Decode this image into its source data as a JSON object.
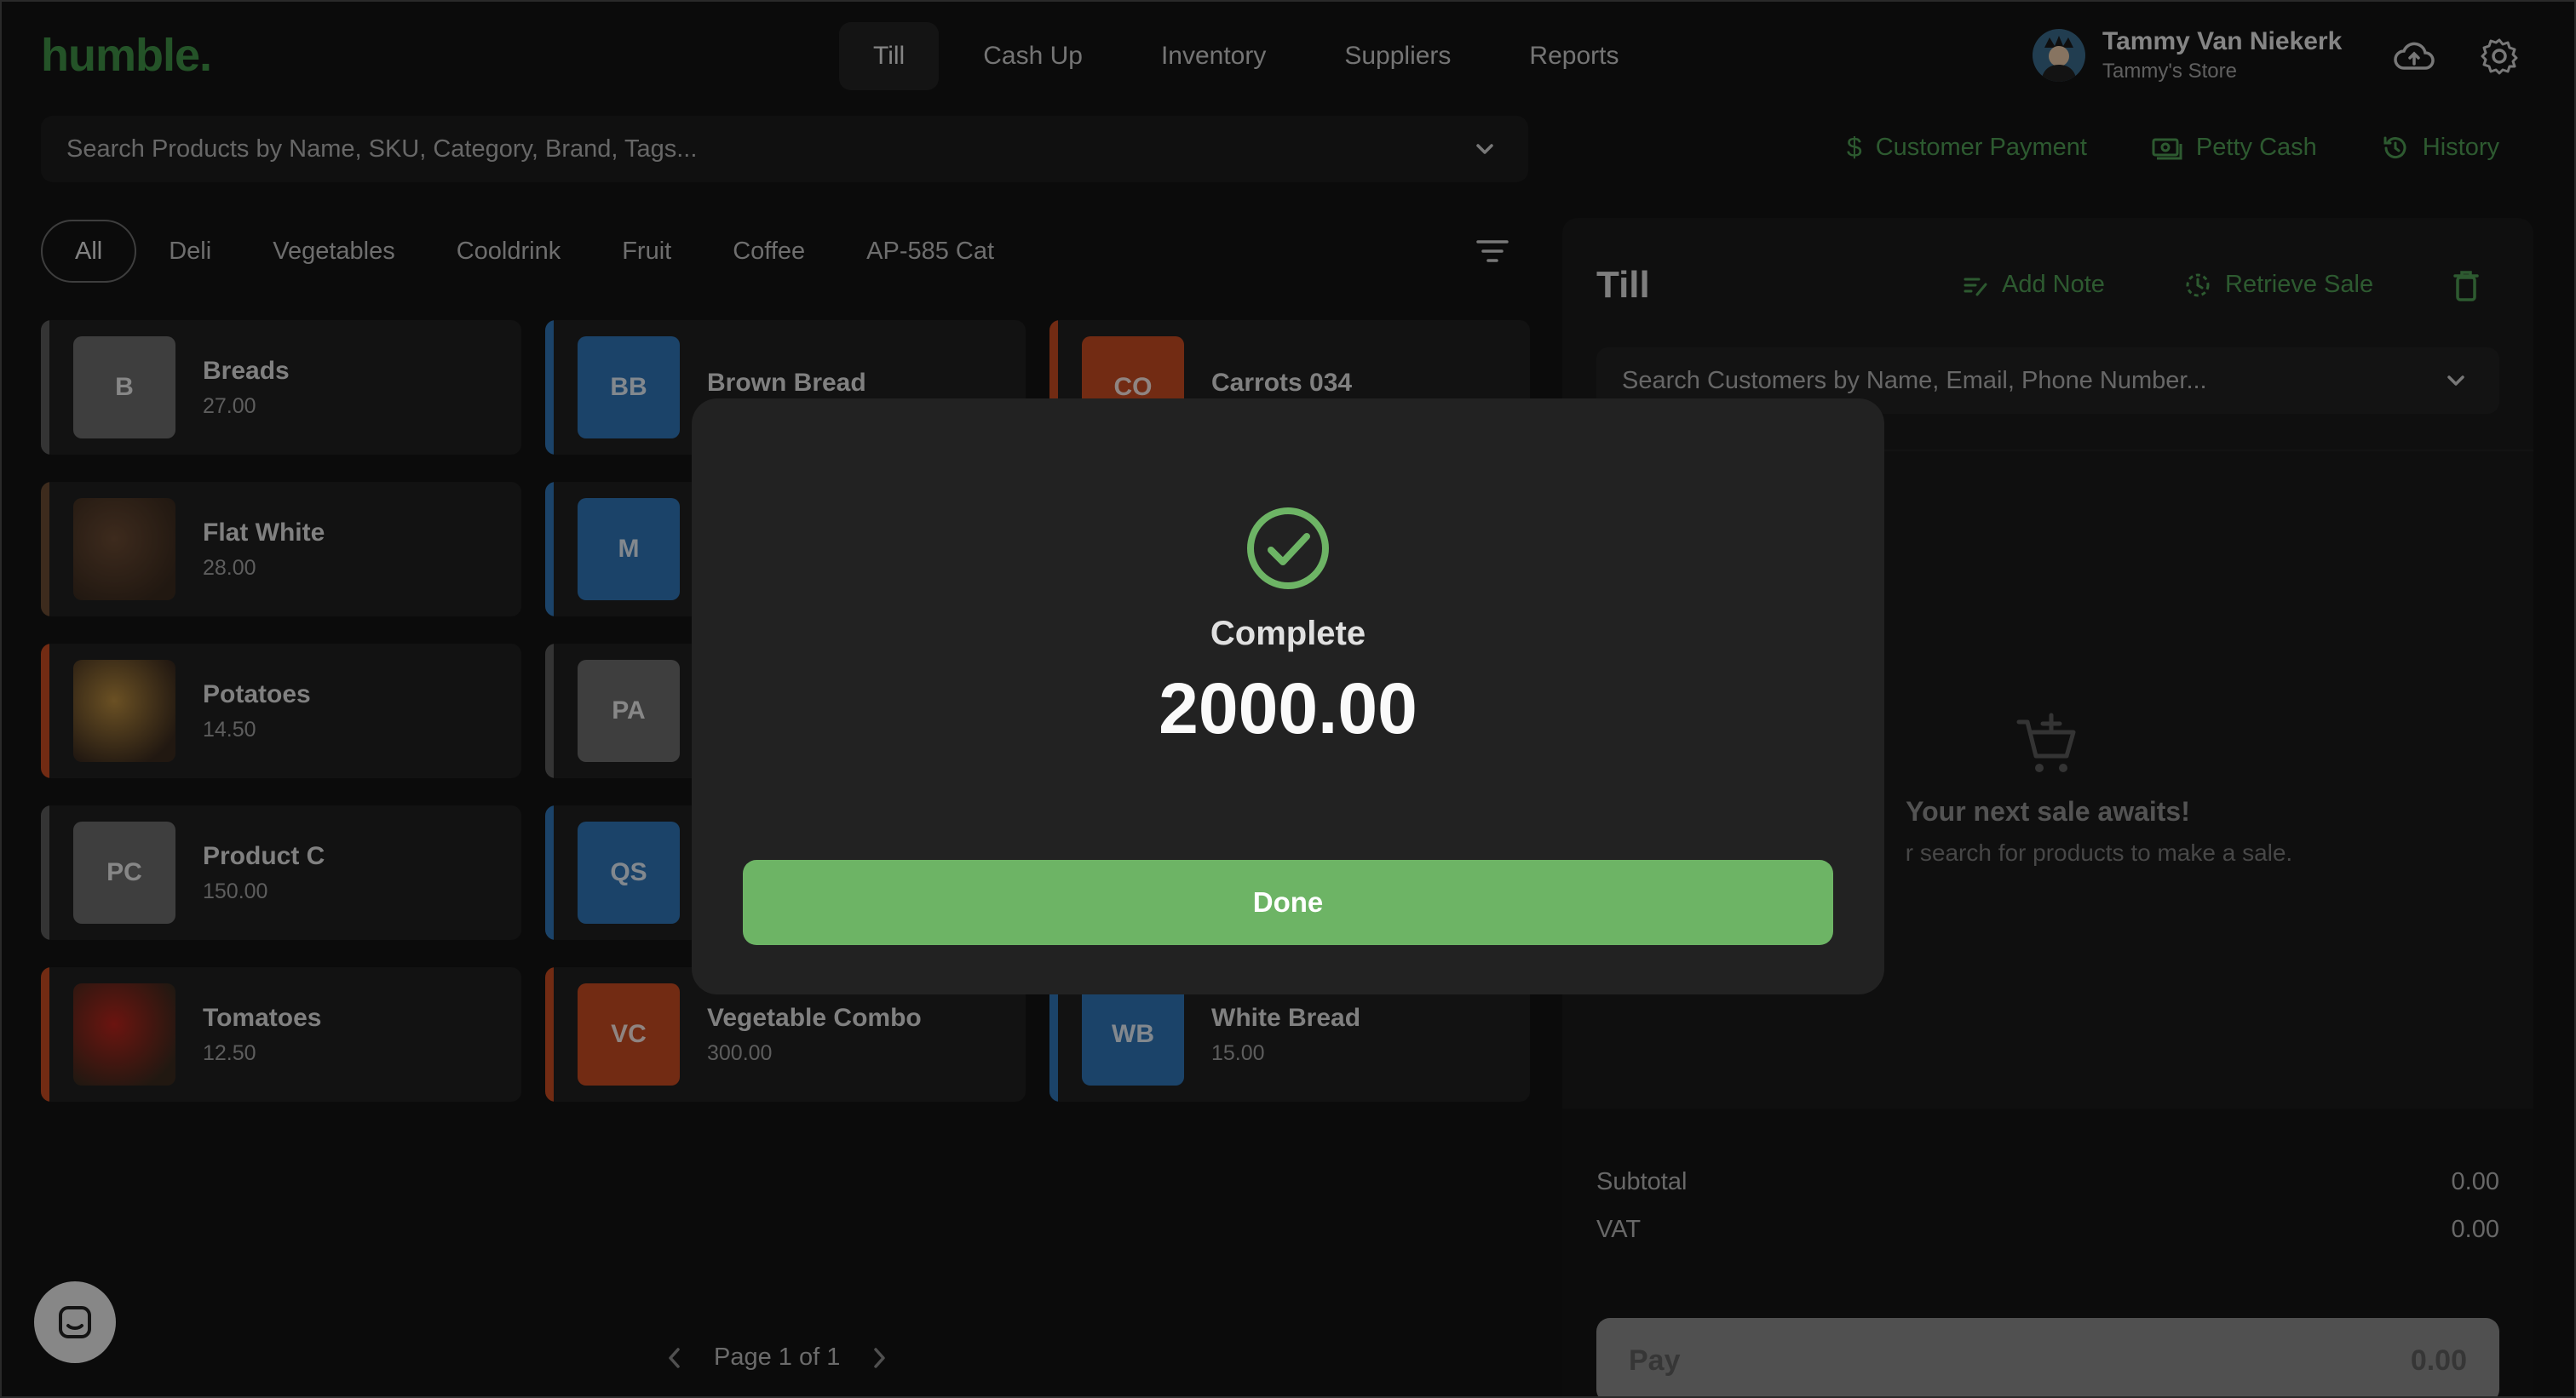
{
  "app": {
    "logo": "humble."
  },
  "nav": [
    "Till",
    "Cash Up",
    "Inventory",
    "Suppliers",
    "Reports"
  ],
  "user": {
    "name": "Tammy Van Niekerk",
    "store": "Tammy's Store"
  },
  "product_search": {
    "placeholder": "Search Products by Name, SKU, Category, Brand, Tags..."
  },
  "actions": {
    "customer_payment": "Customer Payment",
    "petty_cash": "Petty Cash",
    "history": "History"
  },
  "categories": [
    "All",
    "Deli",
    "Vegetables",
    "Cooldrink",
    "Fruit",
    "Coffee",
    "AP-585 Cat"
  ],
  "products": [
    {
      "name": "Breads",
      "price": "27.00",
      "initials": "B",
      "color": "#6b6b6b",
      "stripe": "#5a5a5a"
    },
    {
      "name": "Brown Bread",
      "price": "",
      "initials": "BB",
      "color": "#2f74b5",
      "stripe": "#2f74b5"
    },
    {
      "name": "Carrots 034",
      "price": "",
      "initials": "CO",
      "color": "#c44a22",
      "stripe": "#c44a22"
    },
    {
      "name": "Flat White",
      "price": "28.00",
      "initials": "",
      "color": "#6a4a33",
      "stripe": "#6a4a33"
    },
    {
      "name": "",
      "price": "",
      "initials": "M",
      "color": "#2f74b5",
      "stripe": "#2f74b5"
    },
    {
      "name": "",
      "price": "",
      "initials": "",
      "color": "#1f1f1f",
      "stripe": "#1f1f1f"
    },
    {
      "name": "Potatoes",
      "price": "14.50",
      "initials": "",
      "color": "#b88b3e",
      "stripe": "#c44a22"
    },
    {
      "name": "",
      "price": "",
      "initials": "PA",
      "color": "#6b6b6b",
      "stripe": "#5a5a5a"
    },
    {
      "name": "",
      "price": "",
      "initials": "",
      "color": "#1f1f1f",
      "stripe": "#1f1f1f"
    },
    {
      "name": "Product C",
      "price": "150.00",
      "initials": "PC",
      "color": "#6b6b6b",
      "stripe": "#5a5a5a"
    },
    {
      "name": "",
      "price": "",
      "initials": "QS",
      "color": "#2f74b5",
      "stripe": "#2f74b5"
    },
    {
      "name": "",
      "price": "",
      "initials": "",
      "color": "#1f1f1f",
      "stripe": "#1f1f1f"
    },
    {
      "name": "Tomatoes",
      "price": "12.50",
      "initials": "",
      "color": "#b9241c",
      "stripe": "#c44a22"
    },
    {
      "name": "Vegetable Combo",
      "price": "300.00",
      "initials": "VC",
      "color": "#c44a22",
      "stripe": "#c44a22"
    },
    {
      "name": "White Bread",
      "price": "15.00",
      "initials": "WB",
      "color": "#2f74b5",
      "stripe": "#2f74b5"
    }
  ],
  "pagination": {
    "label": "Page 1 of 1"
  },
  "till": {
    "title": "Till",
    "add_note": "Add Note",
    "retrieve_sale": "Retrieve Sale",
    "customer_search_placeholder": "Search Customers by Name, Email, Phone Number...",
    "empty_title": "Your next sale awaits!",
    "empty_subtitle": "r search for products to make a sale.",
    "subtotal_label": "Subtotal",
    "subtotal_value": "0.00",
    "vat_label": "VAT",
    "vat_value": "0.00",
    "pay_label": "Pay",
    "pay_value": "0.00"
  },
  "modal": {
    "title": "Complete",
    "amount": "2000.00",
    "done_label": "Done"
  },
  "colors": {
    "accent_green": "#4f9b54",
    "done_button": "#6db465",
    "background": "#141414"
  }
}
